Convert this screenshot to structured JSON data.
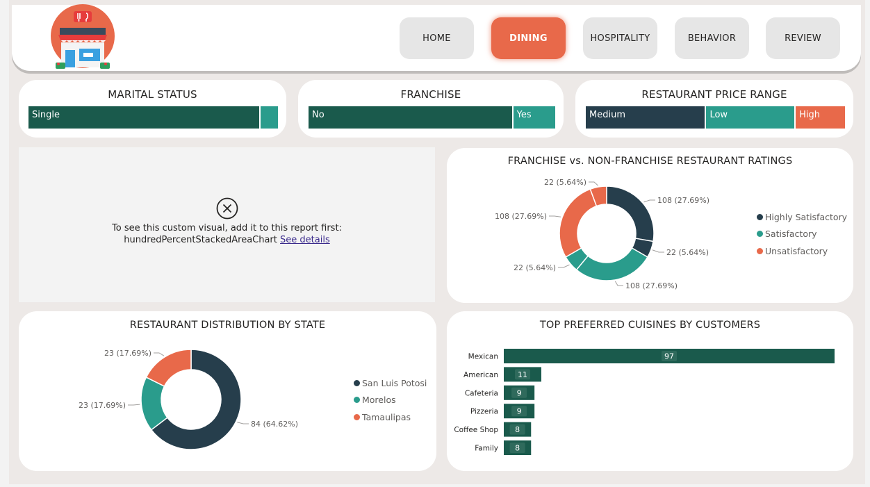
{
  "nav": {
    "items": [
      {
        "label": "HOME",
        "active": false
      },
      {
        "label": "DINING",
        "active": true
      },
      {
        "label": "HOSPITALITY",
        "active": false
      },
      {
        "label": "BEHAVIOR",
        "active": false
      },
      {
        "label": "REVIEW",
        "active": false
      }
    ]
  },
  "colors": {
    "dark_green": "#1a5a4c",
    "navy": "#263e4c",
    "teal": "#2a9c8c",
    "orange": "#e8694a"
  },
  "marital_status": {
    "title": "MARITAL STATUS",
    "segments": [
      {
        "label": "Single",
        "share": 0.93,
        "color": "#1a5a4c"
      },
      {
        "label": "",
        "share": 0.07,
        "color": "#2a9c8c"
      }
    ]
  },
  "franchise": {
    "title": "FRANCHISE",
    "segments": [
      {
        "label": "No",
        "share": 0.83,
        "color": "#1a5a4c"
      },
      {
        "label": "Yes",
        "share": 0.17,
        "color": "#2a9c8c"
      }
    ]
  },
  "price_range": {
    "title": "RESTAURANT PRICE RANGE",
    "segments": [
      {
        "label": "Medium",
        "share": 0.465,
        "color": "#263e4c"
      },
      {
        "label": "Low",
        "share": 0.345,
        "color": "#2a9c8c"
      },
      {
        "label": "High",
        "share": 0.19,
        "color": "#e8694a"
      }
    ]
  },
  "custom_visual_error": {
    "message": "To see this custom visual, add it to this report first: hundredPercentStackedAreaChart",
    "link_text": "See details"
  },
  "chart_data": [
    {
      "type": "pie",
      "title": "FRANCHISE vs. NON-FRANCHISE RESTAURANT RATINGS",
      "legend_position": "right",
      "legend": [
        {
          "name": "Highly Satisfactory",
          "color": "#263e4c"
        },
        {
          "name": "Satisfactory",
          "color": "#2a9c8c"
        },
        {
          "name": "Unsatisfactory",
          "color": "#e8694a"
        }
      ],
      "slices": [
        {
          "category": "Highly Satisfactory",
          "value": 108,
          "label": "108 (27.69%)",
          "color": "#263e4c"
        },
        {
          "category": "Highly Satisfactory",
          "value": 22,
          "label": "22 (5.64%)",
          "color": "#263e4c"
        },
        {
          "category": "Satisfactory",
          "value": 108,
          "label": "108 (27.69%)",
          "color": "#2a9c8c"
        },
        {
          "category": "Satisfactory",
          "value": 22,
          "label": "22 (5.64%)",
          "color": "#2a9c8c"
        },
        {
          "category": "Unsatisfactory",
          "value": 108,
          "label": "108 (27.69%)",
          "color": "#e8694a"
        },
        {
          "category": "Unsatisfactory",
          "value": 22,
          "label": "22 (5.64%)",
          "color": "#e8694a"
        }
      ]
    },
    {
      "type": "pie",
      "title": "RESTAURANT DISTRIBUTION BY STATE",
      "legend_position": "right",
      "legend": [
        {
          "name": "San Luis Potosi",
          "color": "#263e4c"
        },
        {
          "name": "Morelos",
          "color": "#2a9c8c"
        },
        {
          "name": "Tamaulipas",
          "color": "#e8694a"
        }
      ],
      "slices": [
        {
          "category": "San Luis Potosi",
          "value": 84,
          "label": "84 (64.62%)",
          "color": "#263e4c"
        },
        {
          "category": "Morelos",
          "value": 23,
          "label": "23 (17.69%)",
          "color": "#2a9c8c"
        },
        {
          "category": "Tamaulipas",
          "value": 23,
          "label": "23 (17.69%)",
          "color": "#e8694a"
        }
      ]
    },
    {
      "type": "bar",
      "orientation": "horizontal",
      "title": "TOP PREFERRED CUISINES BY CUSTOMERS",
      "categories": [
        "Mexican",
        "American",
        "Cafeteria",
        "Pizzeria",
        "Coffee Shop",
        "Family"
      ],
      "values": [
        97,
        11,
        9,
        9,
        8,
        8
      ],
      "color": "#1a5a4c",
      "xlim": [
        0,
        97
      ]
    }
  ]
}
